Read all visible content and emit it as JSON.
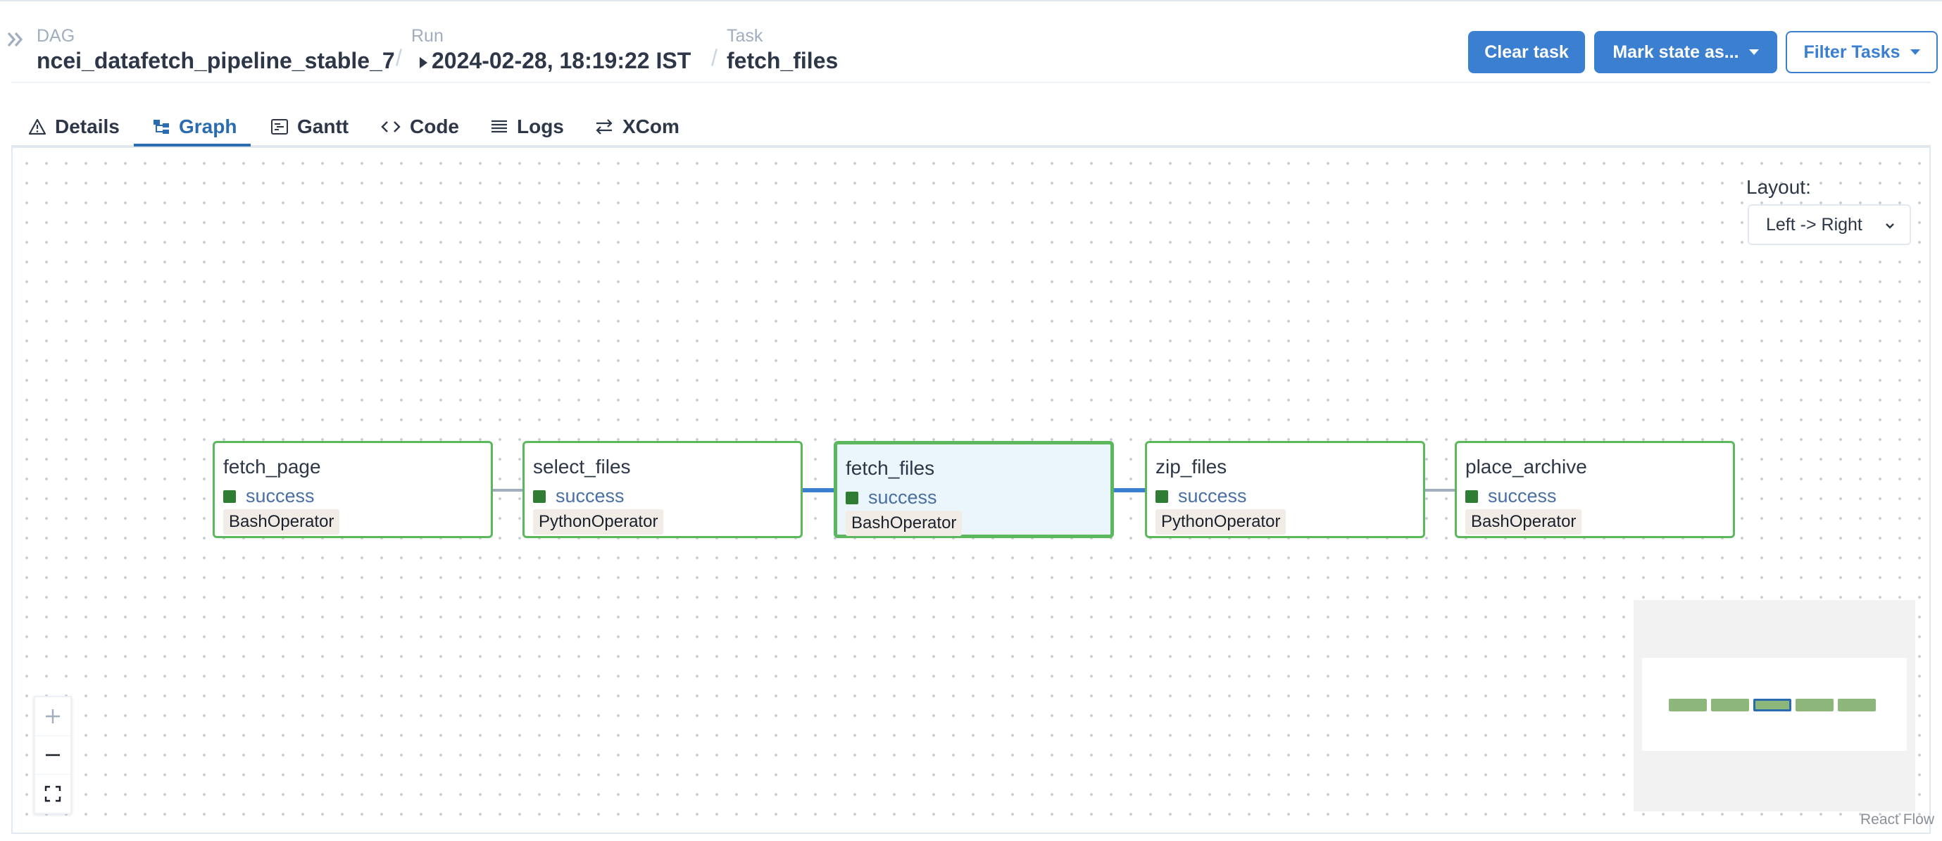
{
  "breadcrumb": {
    "dag_label": "DAG",
    "dag_value": "ncei_datafetch_pipeline_stable_7",
    "run_label": "Run",
    "run_value": "2024-02-28, 18:19:22 IST",
    "task_label": "Task",
    "task_value": "fetch_files",
    "separator": "/"
  },
  "actions": {
    "clear_task": "Clear task",
    "mark_state": "Mark state as...",
    "filter_tasks": "Filter Tasks"
  },
  "tabs": [
    {
      "label": "Details",
      "icon": "warning-triangle-icon"
    },
    {
      "label": "Graph",
      "icon": "graph-icon",
      "active": true
    },
    {
      "label": "Gantt",
      "icon": "gantt-icon"
    },
    {
      "label": "Code",
      "icon": "code-icon"
    },
    {
      "label": "Logs",
      "icon": "logs-icon"
    },
    {
      "label": "XCom",
      "icon": "xcom-icon"
    }
  ],
  "graph": {
    "layout_label": "Layout:",
    "layout_value": "Left -> Right",
    "nodes": [
      {
        "name": "fetch_page",
        "state": "success",
        "operator": "BashOperator"
      },
      {
        "name": "select_files",
        "state": "success",
        "operator": "PythonOperator"
      },
      {
        "name": "fetch_files",
        "state": "success",
        "operator": "BashOperator",
        "selected": true
      },
      {
        "name": "zip_files",
        "state": "success",
        "operator": "PythonOperator"
      },
      {
        "name": "place_archive",
        "state": "success",
        "operator": "BashOperator"
      }
    ],
    "attribution": "React Flow"
  },
  "colors": {
    "primary": "#3b7fd1",
    "success_border": "#5cb85c",
    "success_square": "#2e7d32",
    "selected_bg": "#ebf5fc"
  }
}
